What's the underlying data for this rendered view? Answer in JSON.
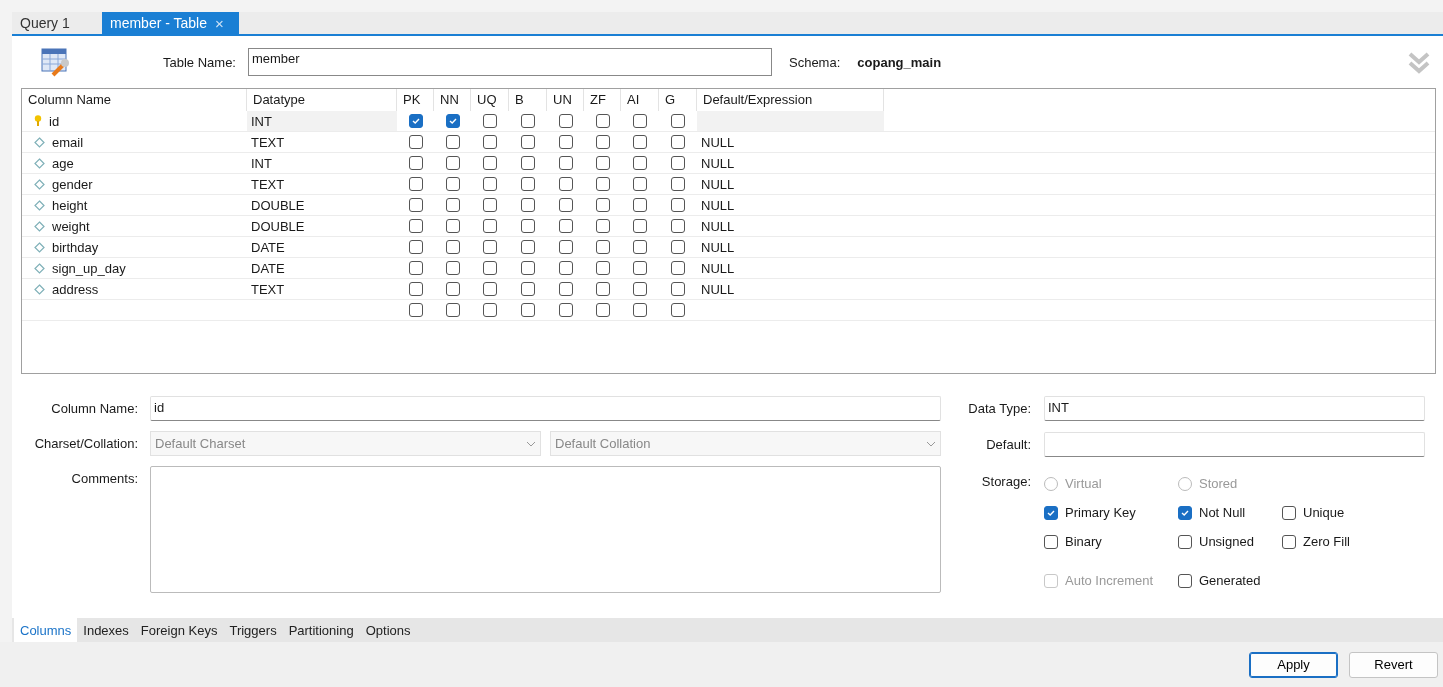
{
  "tabs": [
    {
      "label": "Query 1",
      "selected": false
    },
    {
      "label": "member - Table",
      "selected": true,
      "close": "×"
    }
  ],
  "header": {
    "table_name_label": "Table Name:",
    "table_name": "member",
    "schema_label": "Schema:",
    "schema": "copang_main"
  },
  "grid": {
    "columns": [
      "Column Name",
      "Datatype",
      "PK",
      "NN",
      "UQ",
      "B",
      "UN",
      "ZF",
      "AI",
      "G",
      "Default/Expression"
    ],
    "rows": [
      {
        "kind": "primary",
        "name": "id",
        "datatype": "INT",
        "checks": [
          true,
          true,
          false,
          false,
          false,
          false,
          false,
          false
        ],
        "selected": true
      },
      {
        "kind": "column",
        "name": "email",
        "datatype": "TEXT",
        "checks": [
          false,
          false,
          false,
          false,
          false,
          false,
          false,
          false
        ],
        "default": "NULL",
        "selected": false
      },
      {
        "kind": "column",
        "name": "age",
        "datatype": "INT",
        "checks": [
          false,
          false,
          false,
          false,
          false,
          false,
          false,
          false
        ],
        "default": "NULL",
        "selected": false
      },
      {
        "kind": "column",
        "name": "gender",
        "datatype": "TEXT",
        "checks": [
          false,
          false,
          false,
          false,
          false,
          false,
          false,
          false
        ],
        "default": "NULL",
        "selected": false
      },
      {
        "kind": "column",
        "name": "height",
        "datatype": "DOUBLE",
        "checks": [
          false,
          false,
          false,
          false,
          false,
          false,
          false,
          false
        ],
        "default": "NULL",
        "selected": false
      },
      {
        "kind": "column",
        "name": "weight",
        "datatype": "DOUBLE",
        "checks": [
          false,
          false,
          false,
          false,
          false,
          false,
          false,
          false
        ],
        "default": "NULL",
        "selected": false
      },
      {
        "kind": "column",
        "name": "birthday",
        "datatype": "DATE",
        "checks": [
          false,
          false,
          false,
          false,
          false,
          false,
          false,
          false
        ],
        "default": "NULL",
        "selected": false
      },
      {
        "kind": "column",
        "name": "sign_up_day",
        "datatype": "DATE",
        "checks": [
          false,
          false,
          false,
          false,
          false,
          false,
          false,
          false
        ],
        "default": "NULL",
        "selected": false
      },
      {
        "kind": "column",
        "name": "address",
        "datatype": "TEXT",
        "checks": [
          false,
          false,
          false,
          false,
          false,
          false,
          false,
          false
        ],
        "default": "NULL",
        "selected": false
      },
      {
        "kind": "new",
        "checks": [
          false,
          false,
          false,
          false,
          false,
          false,
          false,
          false
        ],
        "selected": false
      }
    ]
  },
  "details": {
    "column_name_label": "Column Name:",
    "column_name": "id",
    "charset_label": "Charset/Collation:",
    "charset": {
      "value": "Default Charset",
      "disabled": true
    },
    "collation": {
      "value": "Default Collation",
      "disabled": true
    },
    "comments_label": "Comments:",
    "data_type_label": "Data Type:",
    "data_type": "INT",
    "default_label": "Default:",
    "storage_label": "Storage:",
    "storage": [
      {
        "label": "Virtual",
        "selected": false,
        "disabled": true
      },
      {
        "label": "Stored",
        "selected": false,
        "disabled": true
      }
    ],
    "options": [
      {
        "label": "Primary Key",
        "checked": true,
        "disabled": false
      },
      {
        "label": "Not Null",
        "checked": true,
        "disabled": false
      },
      {
        "label": "Unique",
        "checked": false,
        "disabled": false
      },
      {
        "label": "Binary",
        "checked": false,
        "disabled": false
      },
      {
        "label": "Unsigned",
        "checked": false,
        "disabled": false
      },
      {
        "label": "Zero Fill",
        "checked": false,
        "disabled": false
      },
      {
        "label": "Auto Increment",
        "checked": false,
        "disabled": true
      },
      {
        "label": "Generated",
        "checked": false,
        "disabled": false
      }
    ]
  },
  "bottom_tabs": [
    {
      "label": "Columns",
      "selected": true
    },
    {
      "label": "Indexes",
      "selected": false
    },
    {
      "label": "Foreign Keys",
      "selected": false
    },
    {
      "label": "Triggers",
      "selected": false
    },
    {
      "label": "Partitioning",
      "selected": false
    },
    {
      "label": "Options",
      "selected": false
    }
  ],
  "buttons": [
    {
      "label": "Apply",
      "default": true
    },
    {
      "label": "Revert",
      "default": false
    }
  ]
}
